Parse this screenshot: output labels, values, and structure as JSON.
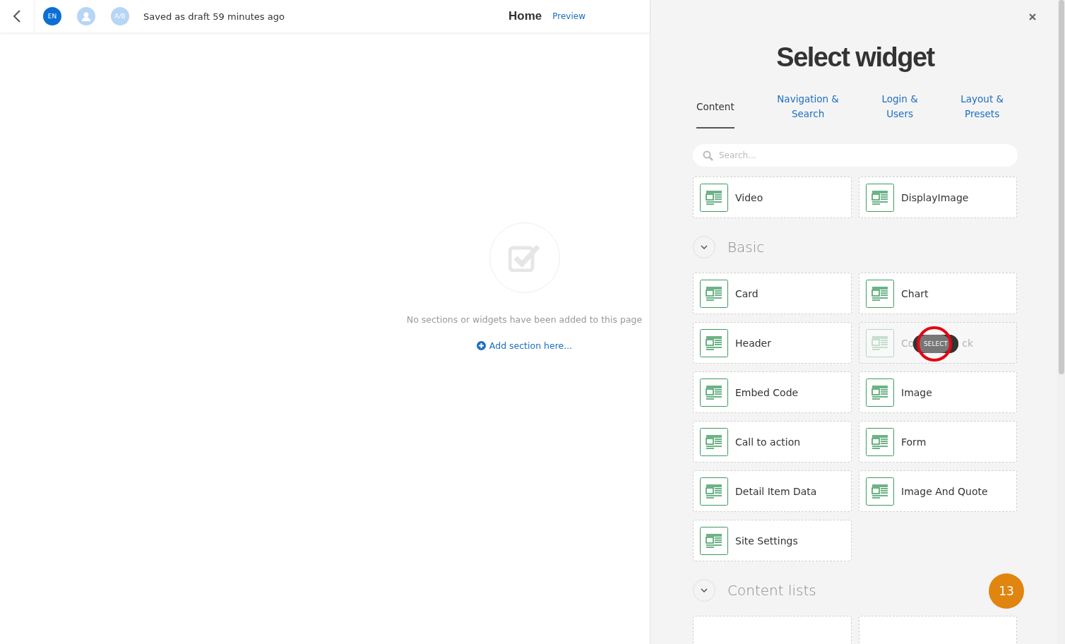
{
  "header": {
    "languages": [
      {
        "label": "EN",
        "selected": true
      }
    ],
    "ab_label": "A/B",
    "status": "Saved as draft 59 minutes ago",
    "page_title": "Home",
    "preview_link": "Preview"
  },
  "canvas": {
    "empty_message": "No sections or widgets have been added to this page",
    "add_link": "Add section here..."
  },
  "panel": {
    "title": "Select widget",
    "tabs": [
      {
        "label": "Content",
        "selected": true
      },
      {
        "label": "Navigation &\nSearch",
        "selected": false
      },
      {
        "label": "Login &\nUsers",
        "selected": false
      },
      {
        "label": "Layout &\nPresets",
        "selected": false
      }
    ],
    "search": {
      "placeholder": "Search..."
    },
    "groups": [
      {
        "tiles": [
          {
            "label": "Video",
            "hovered": false
          },
          {
            "label": "DisplayImage",
            "hovered": false
          }
        ]
      },
      {
        "title": "Basic",
        "expanded": true,
        "tiles": [
          {
            "label": "Card",
            "hovered": false
          },
          {
            "label": "Chart",
            "hovered": false
          },
          {
            "label": "Header",
            "hovered": false
          },
          {
            "label_start": "Co",
            "label_end": "ck",
            "hovered": true,
            "tooltip": "SELECT"
          },
          {
            "label": "Embed Code",
            "hovered": false
          },
          {
            "label": "Image",
            "hovered": false
          },
          {
            "label": "Call to action",
            "hovered": false
          },
          {
            "label": "Form",
            "hovered": false
          },
          {
            "label": "Detail Item Data",
            "hovered": false
          },
          {
            "label": "Image And Quote",
            "hovered": false
          },
          {
            "label": "Site Settings",
            "hovered": false
          }
        ]
      },
      {
        "title": "Content lists",
        "expanded": true,
        "tiles": [
          {
            "kind": "cut"
          },
          {
            "kind": "cut"
          }
        ]
      }
    ]
  },
  "step_badge": "13"
}
